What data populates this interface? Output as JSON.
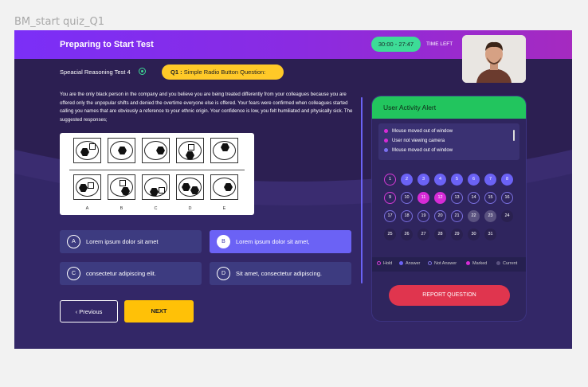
{
  "frame_label": "BM_start quiz_Q1",
  "header": {
    "title": "Preparing to Start Test",
    "timer": "30:00 - 27:47",
    "time_left": "TIME LEFT"
  },
  "test": {
    "name": "Speacial Reasoning Test 4",
    "question_prefix": "Q1 :",
    "question_type": "Simple Radio Button Question:"
  },
  "question_text": "You are the only black person in the company and you believe you are being treated differently from your colleagues because you are offered only the unpopular shifts and denied the overtime everyone else is offered. Your fears were confirmed when colleagues started calling you names that are obviously a reference to your ethnic origin. Your confidence is low, you felt humiliated and physically sick. The suggested responses;",
  "figure": {
    "labels": [
      "A",
      "B",
      "C",
      "D",
      "E"
    ]
  },
  "options": [
    {
      "letter": "A",
      "text": "Lorem ipsum dolor sit amet",
      "selected": false
    },
    {
      "letter": "B",
      "text": "Lorem ipsum dolor sit amet,",
      "selected": true
    },
    {
      "letter": "C",
      "text": "consectetur adipiscing elit.",
      "selected": false
    },
    {
      "letter": "D",
      "text": "Sit amet, consectetur adipiscing.",
      "selected": false
    }
  ],
  "nav": {
    "previous": "Previous",
    "next": "NEXT"
  },
  "panel": {
    "title": "User Activity Alert",
    "alerts": [
      {
        "text": "Mouse moved out of window",
        "color": "#d62bd6"
      },
      {
        "text": "User not viewing camera",
        "color": "#d62bd6"
      },
      {
        "text": "Mouse moved out of window",
        "color": "#7a70f0"
      }
    ],
    "questions": [
      {
        "n": "1",
        "s": "hold"
      },
      {
        "n": "2",
        "s": "answer"
      },
      {
        "n": "3",
        "s": "answer"
      },
      {
        "n": "4",
        "s": "answer"
      },
      {
        "n": "5",
        "s": "answer"
      },
      {
        "n": "6",
        "s": "answer"
      },
      {
        "n": "7",
        "s": "answer"
      },
      {
        "n": "8",
        "s": "answer"
      },
      {
        "n": "9",
        "s": "hold"
      },
      {
        "n": "10",
        "s": "notanswer"
      },
      {
        "n": "11",
        "s": "marked"
      },
      {
        "n": "12",
        "s": "marked"
      },
      {
        "n": "13",
        "s": "notanswer"
      },
      {
        "n": "14",
        "s": "notanswer"
      },
      {
        "n": "15",
        "s": "notanswer"
      },
      {
        "n": "16",
        "s": "notanswer"
      },
      {
        "n": "17",
        "s": "notanswer"
      },
      {
        "n": "18",
        "s": "notanswer"
      },
      {
        "n": "19",
        "s": "notanswer"
      },
      {
        "n": "20",
        "s": "notanswer"
      },
      {
        "n": "21",
        "s": "notanswer"
      },
      {
        "n": "22",
        "s": "current"
      },
      {
        "n": "23",
        "s": "current"
      },
      {
        "n": "24",
        "s": "plain"
      },
      {
        "n": "25",
        "s": "plain"
      },
      {
        "n": "26",
        "s": "plain"
      },
      {
        "n": "27",
        "s": "plain"
      },
      {
        "n": "28",
        "s": "plain"
      },
      {
        "n": "29",
        "s": "plain"
      },
      {
        "n": "30",
        "s": "plain"
      },
      {
        "n": "31",
        "s": "plain"
      }
    ],
    "legend": [
      {
        "label": "Hold",
        "style": "hold"
      },
      {
        "label": "Answer",
        "style": "answer"
      },
      {
        "label": "Not Answer",
        "style": "notanswer"
      },
      {
        "label": "Marked",
        "style": "marked"
      },
      {
        "label": "Current",
        "style": "current"
      }
    ],
    "report": "REPORT QUESTION"
  },
  "colors": {
    "header_start": "#7b2ff7",
    "header_end": "#a52ac0",
    "timer": "#3ddc97",
    "badge": "#ffc928",
    "next": "#ffc107",
    "panel_head": "#22c55e",
    "report": "#e0354e",
    "option_selected": "#6b62f5"
  }
}
